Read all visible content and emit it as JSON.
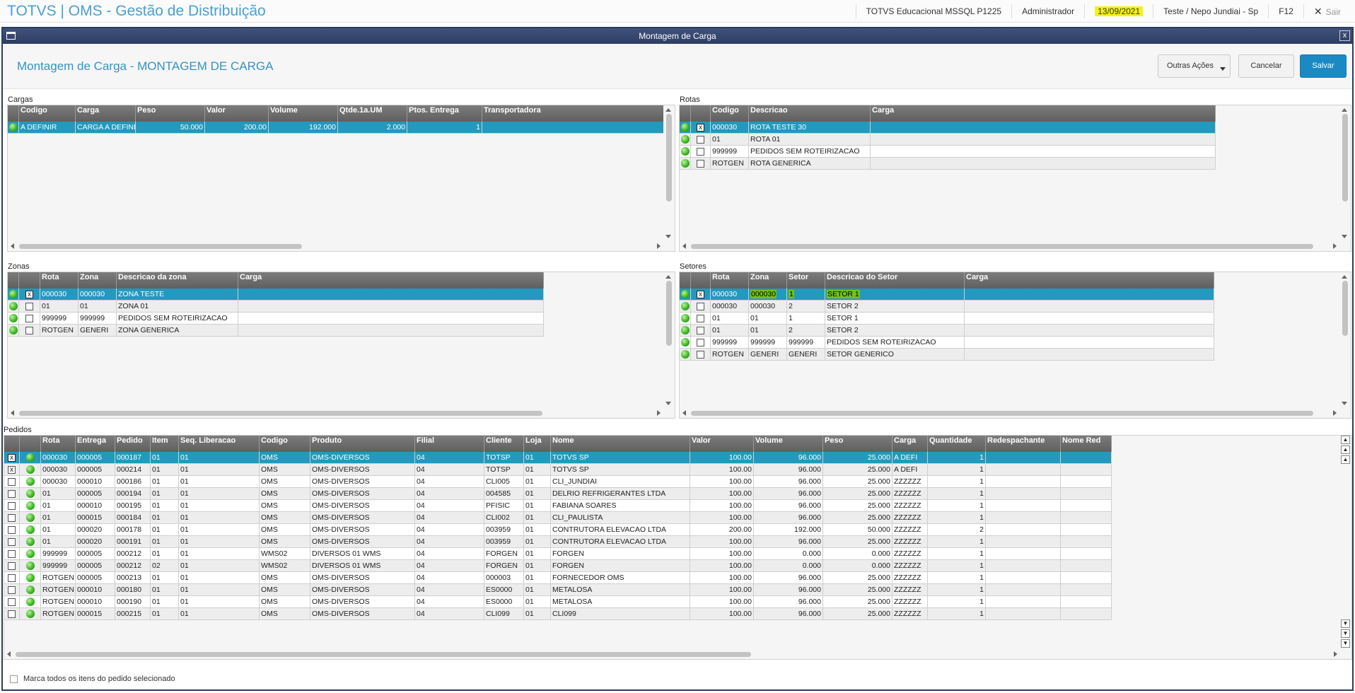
{
  "app": {
    "title": "TOTVS | OMS - Gestão de Distribuição",
    "env": "TOTVS Educacional MSSQL P1225",
    "user": "Administrador",
    "date": "13/09/2021",
    "branch": "Teste / Nepo Jundiai - Sp",
    "f12": "F12",
    "logout": "Sair",
    "close_glyph": "✕"
  },
  "window": {
    "title": "Montagem de Carga",
    "close": "x"
  },
  "page": {
    "title": "Montagem de Carga - MONTAGEM DE CARGA",
    "outras": "Outras Ações",
    "cancel": "Cancelar",
    "save": "Salvar"
  },
  "cargas": {
    "label": "Cargas",
    "headers": [
      "",
      "Codigo",
      "Carga",
      "Peso",
      "Valor",
      "Volume",
      "Qtde.1a.UM",
      "Ptos. Entrega",
      "Transportadora"
    ],
    "rows": [
      [
        "A DEFINIR",
        "CARGA A DEFINIR",
        "50.000",
        "200.00",
        "192.000",
        "2.000",
        "1",
        ""
      ]
    ]
  },
  "rotas": {
    "label": "Rotas",
    "headers": [
      "",
      "",
      "Codigo",
      "Descricao",
      "Carga"
    ],
    "rows": [
      [
        "x",
        "000030",
        "ROTA TESTE 30",
        ""
      ],
      [
        "",
        "01",
        "ROTA 01",
        ""
      ],
      [
        "",
        "999999",
        "PEDIDOS SEM ROTEIRIZACAO",
        ""
      ],
      [
        "",
        "ROTGEN",
        "ROTA GENERICA",
        ""
      ]
    ]
  },
  "zonas": {
    "label": "Zonas",
    "headers": [
      "",
      "",
      "Rota",
      "Zona",
      "Descricao da zona",
      "Carga"
    ],
    "rows": [
      [
        "x",
        "000030",
        "000030",
        "ZONA TESTE",
        ""
      ],
      [
        "",
        "01",
        "01",
        "ZONA 01",
        ""
      ],
      [
        "",
        "999999",
        "999999",
        "PEDIDOS SEM ROTEIRIZACAO",
        ""
      ],
      [
        "",
        "ROTGEN",
        "GENERI",
        "ZONA GENERICA",
        ""
      ]
    ]
  },
  "setores": {
    "label": "Setores",
    "headers": [
      "",
      "",
      "Rota",
      "Zona",
      "Setor",
      "Descricao do Setor",
      "Carga"
    ],
    "rows": [
      [
        "x",
        "000030",
        "000030",
        "1",
        "SETOR 1",
        ""
      ],
      [
        "",
        "000030",
        "000030",
        "2",
        "SETOR 2",
        ""
      ],
      [
        "",
        "01",
        "01",
        "1",
        "SETOR 1",
        ""
      ],
      [
        "",
        "01",
        "01",
        "2",
        "SETOR 2",
        ""
      ],
      [
        "",
        "999999",
        "999999",
        "999999",
        "PEDIDOS SEM ROTEIRIZACAO",
        ""
      ],
      [
        "",
        "ROTGEN",
        "GENERI",
        "GENERI",
        "SETOR GENERICO",
        ""
      ]
    ]
  },
  "pedidos": {
    "label": "Pedidos",
    "headers": [
      "",
      "",
      "Rota",
      "Entrega",
      "Pedido",
      "Item",
      "Seq. Liberacao",
      "Codigo",
      "Produto",
      "Filial",
      "Cliente",
      "Loja",
      "Nome",
      "Valor",
      "Volume",
      "Peso",
      "Carga",
      "Quantidade",
      "Redespachante",
      "Nome Red"
    ],
    "rows": [
      [
        "x",
        "000030",
        "000005",
        "000187",
        "01",
        "01",
        "OMS",
        "OMS-DIVERSOS",
        "04",
        "TOTSP",
        "01",
        "TOTVS SP",
        "100.00",
        "96.000",
        "25.000",
        "A DEFI",
        "1",
        "",
        ""
      ],
      [
        "x",
        "000030",
        "000005",
        "000214",
        "01",
        "01",
        "OMS",
        "OMS-DIVERSOS",
        "04",
        "TOTSP",
        "01",
        "TOTVS SP",
        "100.00",
        "96.000",
        "25.000",
        "A DEFI",
        "1",
        "",
        ""
      ],
      [
        "",
        "000030",
        "000010",
        "000186",
        "01",
        "01",
        "OMS",
        "OMS-DIVERSOS",
        "04",
        "CLI005",
        "01",
        "CLI_JUNDIAI",
        "100.00",
        "96.000",
        "25.000",
        "ZZZZZZ",
        "1",
        "",
        ""
      ],
      [
        "",
        "01",
        "000005",
        "000194",
        "01",
        "01",
        "OMS",
        "OMS-DIVERSOS",
        "04",
        "004585",
        "01",
        "DELRIO REFRIGERANTES LTDA",
        "100.00",
        "96.000",
        "25.000",
        "ZZZZZZ",
        "1",
        "",
        ""
      ],
      [
        "",
        "01",
        "000010",
        "000195",
        "01",
        "01",
        "OMS",
        "OMS-DIVERSOS",
        "04",
        "PFISIC",
        "01",
        "FABIANA SOARES",
        "100.00",
        "96.000",
        "25.000",
        "ZZZZZZ",
        "1",
        "",
        ""
      ],
      [
        "",
        "01",
        "000015",
        "000184",
        "01",
        "01",
        "OMS",
        "OMS-DIVERSOS",
        "04",
        "CLI002",
        "01",
        "CLI_PAULISTA",
        "100.00",
        "96.000",
        "25.000",
        "ZZZZZZ",
        "1",
        "",
        ""
      ],
      [
        "",
        "01",
        "000020",
        "000178",
        "01",
        "01",
        "OMS",
        "OMS-DIVERSOS",
        "04",
        "003959",
        "01",
        "CONTRUTORA ELEVACAO LTDA",
        "200.00",
        "192.000",
        "50.000",
        "ZZZZZZ",
        "2",
        "",
        ""
      ],
      [
        "",
        "01",
        "000020",
        "000191",
        "01",
        "01",
        "OMS",
        "OMS-DIVERSOS",
        "04",
        "003959",
        "01",
        "CONTRUTORA ELEVACAO LTDA",
        "100.00",
        "96.000",
        "25.000",
        "ZZZZZZ",
        "1",
        "",
        ""
      ],
      [
        "",
        "999999",
        "000005",
        "000212",
        "01",
        "01",
        "WMS02",
        "DIVERSOS 01 WMS",
        "04",
        "FORGEN",
        "01",
        "FORGEN",
        "100.00",
        "0.000",
        "0.000",
        "ZZZZZZ",
        "1",
        "",
        ""
      ],
      [
        "",
        "999999",
        "000005",
        "000212",
        "02",
        "01",
        "WMS02",
        "DIVERSOS 01 WMS",
        "04",
        "FORGEN",
        "01",
        "FORGEN",
        "100.00",
        "0.000",
        "0.000",
        "ZZZZZZ",
        "1",
        "",
        ""
      ],
      [
        "",
        "ROTGEN",
        "000005",
        "000213",
        "01",
        "01",
        "OMS",
        "OMS-DIVERSOS",
        "04",
        "000003",
        "01",
        "FORNECEDOR OMS",
        "100.00",
        "96.000",
        "25.000",
        "ZZZZZZ",
        "1",
        "",
        ""
      ],
      [
        "",
        "ROTGEN",
        "000010",
        "000180",
        "01",
        "01",
        "OMS",
        "OMS-DIVERSOS",
        "04",
        "ES0000",
        "01",
        "METALOSA",
        "100.00",
        "96.000",
        "25.000",
        "ZZZZZZ",
        "1",
        "",
        ""
      ],
      [
        "",
        "ROTGEN",
        "000010",
        "000190",
        "01",
        "01",
        "OMS",
        "OMS-DIVERSOS",
        "04",
        "ES0000",
        "01",
        "METALOSA",
        "100.00",
        "96.000",
        "25.000",
        "ZZZZZZ",
        "1",
        "",
        ""
      ],
      [
        "",
        "ROTGEN",
        "000015",
        "000215",
        "01",
        "01",
        "OMS",
        "OMS-DIVERSOS",
        "04",
        "CLI099",
        "01",
        "CLI099",
        "100.00",
        "96.000",
        "25.000",
        "ZZZZZZ",
        "1",
        "",
        ""
      ]
    ]
  },
  "footer": {
    "label": "Marca todos os itens do pedido selecionado"
  }
}
